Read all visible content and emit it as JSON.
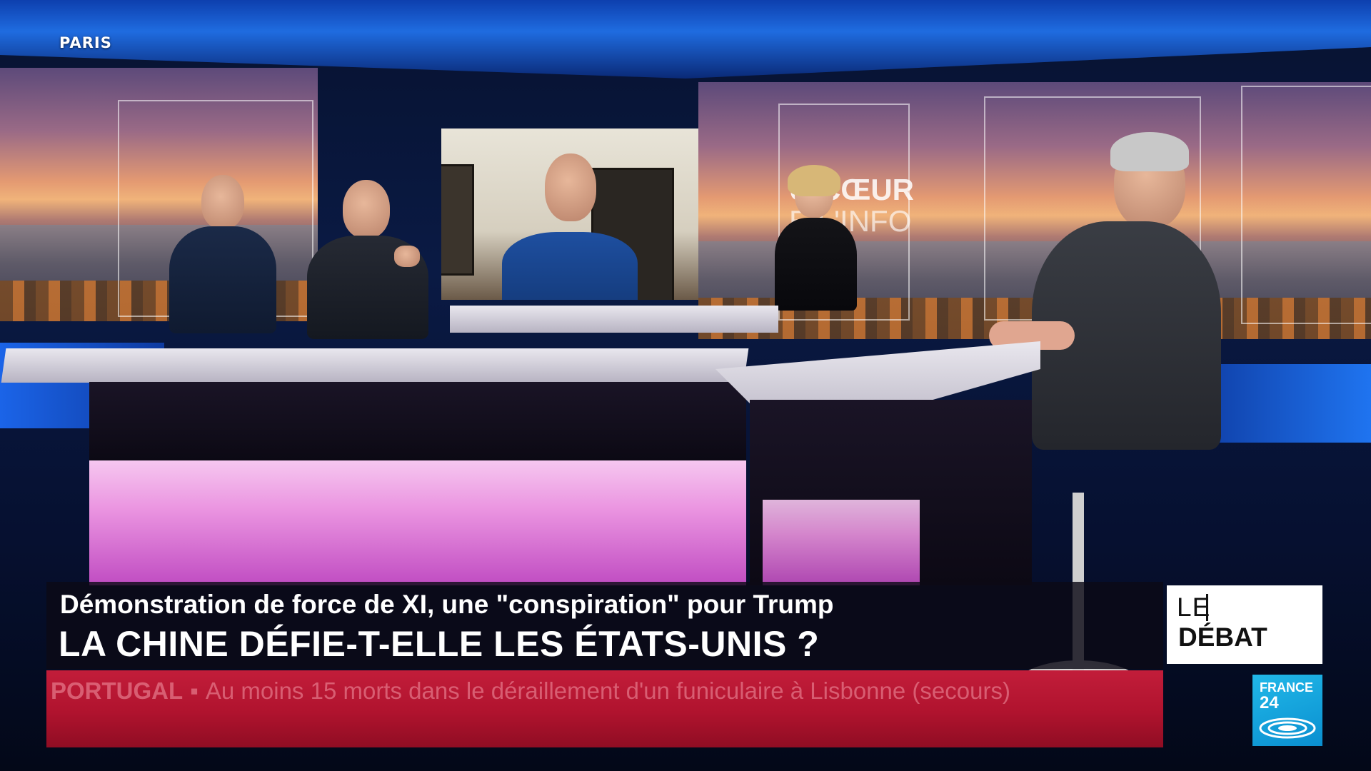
{
  "location": "PARIS",
  "studio_screen_logo": {
    "line1": "U CŒUR",
    "line2": "E L'INFO"
  },
  "lower_third": {
    "subtitle": "Démonstration de force de XI, une \"conspiration\" pour Trump",
    "title": "LA CHINE DÉFIE-T-ELLE LES ÉTATS-UNIS ?"
  },
  "ticker": {
    "tag": "PORTUGAL",
    "separator": "▪",
    "text": "Au moins 15 morts dans le déraillement d'un funiculaire à Lisbonne (secours)"
  },
  "show_badge": {
    "line1": "LE",
    "line2": "DÉBAT"
  },
  "channel_logo": {
    "name": "FRANCE",
    "number": "24"
  },
  "colors": {
    "ticker_red": "#b0132e",
    "studio_blue": "#1f6ce0",
    "desk_glow_pink": "#ea93e0",
    "france24_blue": "#0a8fd0"
  }
}
